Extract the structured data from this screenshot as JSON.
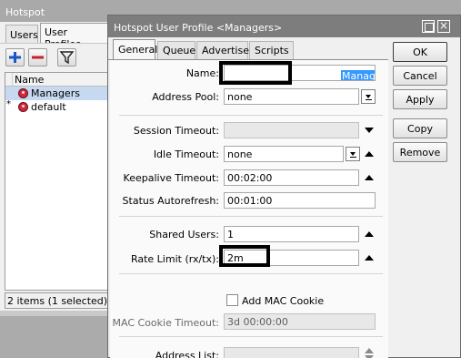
{
  "background_window": {
    "title": "Hotspot",
    "tabs": [
      "Users",
      "User Profiles"
    ],
    "toolbar": {
      "add_icon": "plus-icon",
      "remove_icon": "minus-icon",
      "filter_icon": "filter-icon"
    },
    "list": {
      "columns": [
        "Name"
      ],
      "rows": [
        {
          "marker": "",
          "name": "Managers",
          "icon": "profile-icon",
          "selected": true
        },
        {
          "marker": "*",
          "name": "default",
          "icon": "profile-icon",
          "selected": false
        }
      ]
    },
    "status": "2 items (1 selected)"
  },
  "dialog": {
    "title": "Hotspot User Profile <Managers>",
    "tabs": [
      "General",
      "Queue",
      "Advertise",
      "Scripts"
    ],
    "active_tab": "General",
    "fields": {
      "name": {
        "label": "Name:",
        "value": "Managers"
      },
      "address_pool": {
        "label": "Address Pool:",
        "value": "none"
      },
      "session_timeout": {
        "label": "Session Timeout:",
        "value": ""
      },
      "idle_timeout": {
        "label": "Idle Timeout:",
        "value": "none"
      },
      "keepalive_timeout": {
        "label": "Keepalive Timeout:",
        "value": "00:02:00"
      },
      "status_autorefresh": {
        "label": "Status Autorefresh:",
        "value": "00:01:00"
      },
      "shared_users": {
        "label": "Shared Users:",
        "value": "1"
      },
      "rate_limit": {
        "label": "Rate Limit (rx/tx):",
        "value": "2m"
      },
      "add_mac_cookie": {
        "label": "Add MAC Cookie",
        "checked": false
      },
      "mac_cookie_timeout": {
        "label": "MAC Cookie Timeout:",
        "value": "3d 00:00:00"
      },
      "address_list": {
        "label": "Address List:",
        "value": ""
      }
    },
    "buttons": {
      "ok": "OK",
      "cancel": "Cancel",
      "apply": "Apply",
      "copy": "Copy",
      "remove": "Remove"
    },
    "window_controls": {
      "restore_icon": "restore-icon",
      "close_icon": "close-icon",
      "close_glyph": "×"
    }
  },
  "colors": {
    "selection": "#3399ff",
    "title_bar": "#7d7d7d",
    "highlight_box": "#000000",
    "profile_icon": "#cc2b3a"
  }
}
